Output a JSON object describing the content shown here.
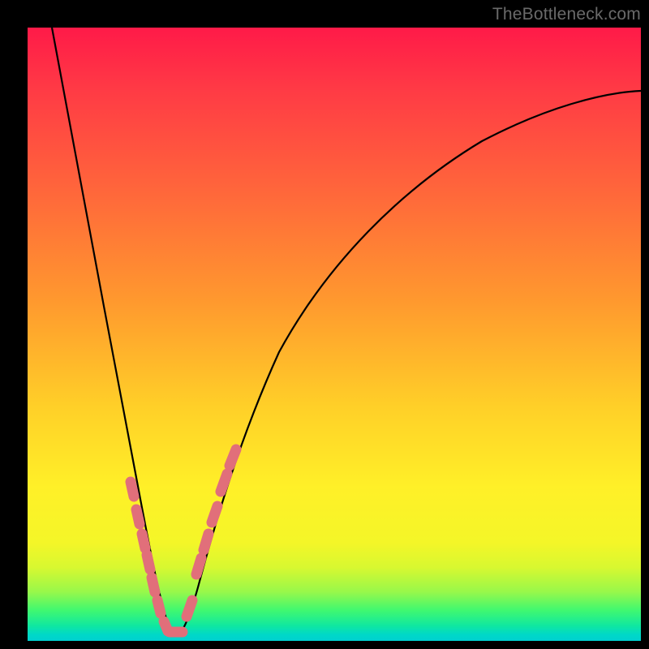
{
  "watermark": {
    "text": "TheBottleneck.com"
  },
  "gradient": {
    "stops": [
      {
        "pct": 0,
        "color": "#ff1a48"
      },
      {
        "pct": 10,
        "color": "#ff3a45"
      },
      {
        "pct": 28,
        "color": "#ff6a3a"
      },
      {
        "pct": 45,
        "color": "#ff9a2e"
      },
      {
        "pct": 62,
        "color": "#ffd028"
      },
      {
        "pct": 75,
        "color": "#fff028"
      },
      {
        "pct": 84,
        "color": "#f4f628"
      },
      {
        "pct": 88,
        "color": "#d8f830"
      },
      {
        "pct": 92,
        "color": "#98f84a"
      },
      {
        "pct": 95,
        "color": "#40f870"
      },
      {
        "pct": 97.5,
        "color": "#10e8a0"
      },
      {
        "pct": 99,
        "color": "#00d8c8"
      },
      {
        "pct": 100,
        "color": "#00d0d0"
      }
    ]
  },
  "chart_data": {
    "type": "line",
    "title": "",
    "xlabel": "",
    "ylabel": "",
    "xlim": [
      0,
      100
    ],
    "ylim": [
      0,
      100
    ],
    "note": "V-shaped bottleneck curve; minimum (optimal match) near x≈23. Coordinates are percentage of plot area (0,0 = top-left).",
    "series": [
      {
        "name": "bottleneck-curve",
        "points": [
          {
            "x": 4.0,
            "y": 0.0
          },
          {
            "x": 6.0,
            "y": 12.0
          },
          {
            "x": 8.0,
            "y": 24.0
          },
          {
            "x": 10.0,
            "y": 36.0
          },
          {
            "x": 12.0,
            "y": 48.0
          },
          {
            "x": 14.0,
            "y": 59.0
          },
          {
            "x": 16.0,
            "y": 70.0
          },
          {
            "x": 18.0,
            "y": 80.0
          },
          {
            "x": 20.0,
            "y": 89.0
          },
          {
            "x": 22.0,
            "y": 96.0
          },
          {
            "x": 23.5,
            "y": 99.0
          },
          {
            "x": 25.0,
            "y": 97.0
          },
          {
            "x": 27.0,
            "y": 90.0
          },
          {
            "x": 29.0,
            "y": 82.0
          },
          {
            "x": 32.0,
            "y": 72.0
          },
          {
            "x": 36.0,
            "y": 62.0
          },
          {
            "x": 41.0,
            "y": 52.0
          },
          {
            "x": 47.0,
            "y": 43.0
          },
          {
            "x": 54.0,
            "y": 35.0
          },
          {
            "x": 62.0,
            "y": 28.0
          },
          {
            "x": 71.0,
            "y": 22.0
          },
          {
            "x": 81.0,
            "y": 17.0
          },
          {
            "x": 92.0,
            "y": 13.0
          },
          {
            "x": 100.0,
            "y": 10.5
          }
        ]
      }
    ],
    "markers": {
      "name": "highlighted-segments",
      "color": "#e16f7a",
      "points_pct": [
        {
          "x": 16.8,
          "y": 74.0
        },
        {
          "x": 17.8,
          "y": 78.5
        },
        {
          "x": 18.7,
          "y": 82.5
        },
        {
          "x": 19.4,
          "y": 86.0
        },
        {
          "x": 20.2,
          "y": 89.5
        },
        {
          "x": 21.0,
          "y": 92.5
        },
        {
          "x": 22.0,
          "y": 95.5
        },
        {
          "x": 23.0,
          "y": 98.0
        },
        {
          "x": 24.2,
          "y": 98.2
        },
        {
          "x": 25.5,
          "y": 96.0
        },
        {
          "x": 27.5,
          "y": 89.0
        },
        {
          "x": 28.6,
          "y": 85.0
        },
        {
          "x": 29.8,
          "y": 80.5
        },
        {
          "x": 31.3,
          "y": 75.5
        },
        {
          "x": 32.8,
          "y": 71.0
        }
      ]
    }
  }
}
